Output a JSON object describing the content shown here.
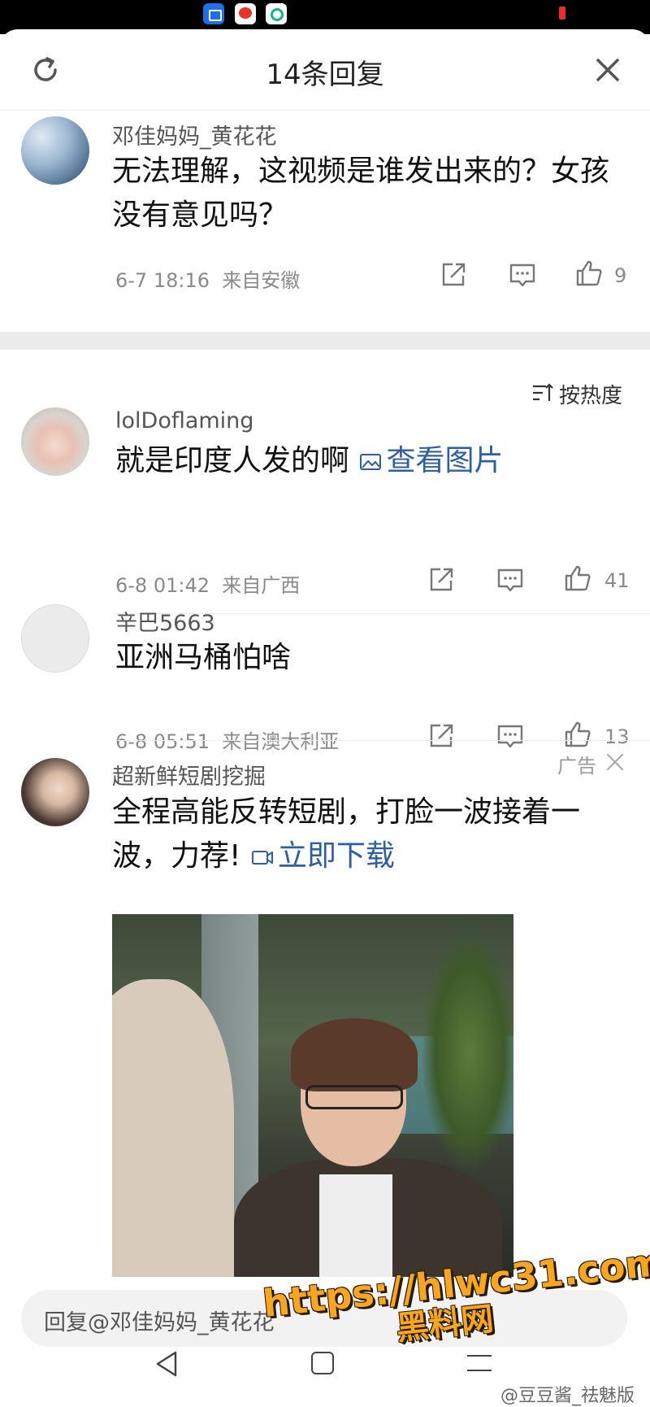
{
  "header": {
    "title": "14条回复"
  },
  "parent_comment": {
    "username": "邓佳妈妈_黄花花",
    "text": "无法理解，这视频是谁发出来的？女孩没有意见吗？",
    "time": "6-7 18:16",
    "location": "来自安徽",
    "likes": "9"
  },
  "sort": {
    "label": "按热度"
  },
  "replies": [
    {
      "username": "lolDoflaming",
      "text": "就是印度人发的啊",
      "link": "查看图片",
      "time": "6-8 01:42",
      "location": "来自广西",
      "likes": "41"
    },
    {
      "username": "辛巴5663",
      "text": "亚洲马桶怕啥",
      "time": "6-8 05:51",
      "location": "来自澳大利亚",
      "likes": "13"
    }
  ],
  "ad": {
    "username": "超新鲜短剧挖掘",
    "tag": "广告",
    "text": "全程高能反转短剧，打脸一波接着一波，力荐!",
    "link": "立即下载"
  },
  "reply_bar": {
    "placeholder": "回复@邓佳妈妈_黄花花"
  },
  "watermark": {
    "url": "https://hlwc31.com",
    "name": "黑料网"
  },
  "credit": "@豆豆酱_祛魅版",
  "colors": {
    "link": "#2f5f9f",
    "watermark": "#f6a623",
    "divider": "#ececec"
  }
}
